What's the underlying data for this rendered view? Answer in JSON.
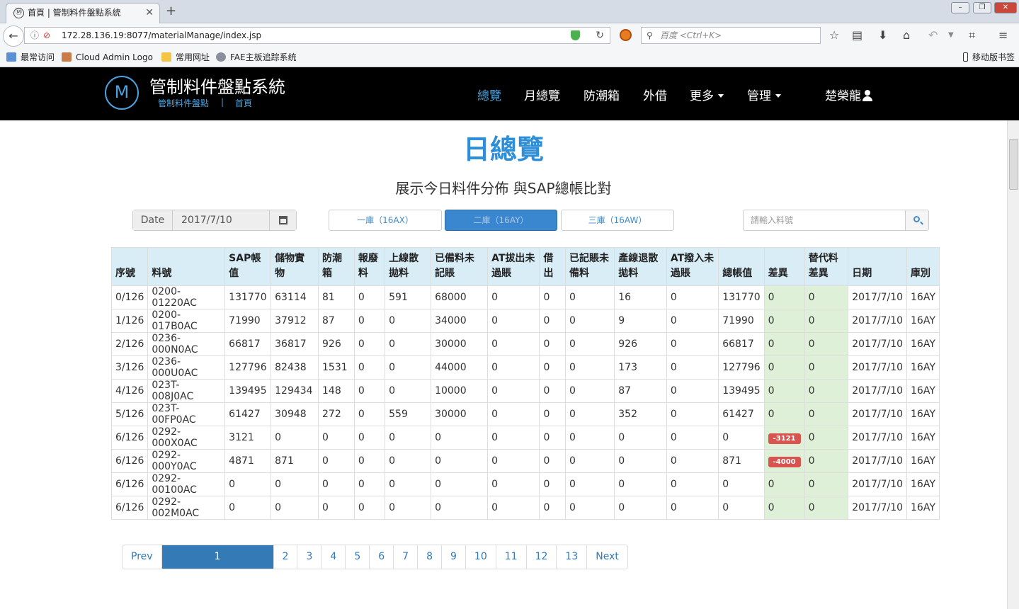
{
  "browser": {
    "tab_title": "首頁 | 管制料件盤點系統",
    "tab_favicon": "Ⓜ",
    "url": "172.28.136.19:8077/materialManage/index.jsp",
    "search_placeholder": "百度 <Ctrl+K>",
    "bookmarks": [
      "最常访问",
      "Cloud Admin Logo",
      "常用网址",
      "FAE主板追踪系统"
    ],
    "mobile_bookmarks": "移动版书签"
  },
  "header": {
    "brand": "管制料件盤點系統",
    "breadcrumb_1": "管制料件盤點",
    "breadcrumb_sep": "|",
    "breadcrumb_2": "首頁",
    "nav": [
      "總覽",
      "月總覽",
      "防潮箱",
      "外借",
      "更多",
      "管理"
    ],
    "user": "楚榮龍"
  },
  "page": {
    "title": "日總覽",
    "subtitle": "展示今日料件分佈 與SAP總帳比對"
  },
  "filters": {
    "date_label": "Date",
    "date_value": "2017/7/10",
    "stores": [
      "一庫（16AX）",
      "二庫（16AY）",
      "三庫（16AW）"
    ],
    "active_store": 1,
    "search_placeholder": "請輸入料號"
  },
  "table": {
    "headers": [
      [
        "序號"
      ],
      [
        "料號"
      ],
      [
        "SAP帳",
        "值"
      ],
      [
        "儲物實",
        "物"
      ],
      [
        "防潮",
        "箱"
      ],
      [
        "報廢",
        "料"
      ],
      [
        "上線散",
        "拋料"
      ],
      [
        "已備料未",
        "記賬"
      ],
      [
        "AT拔出未",
        "過賬"
      ],
      [
        "借",
        "出"
      ],
      [
        "已記賬未",
        "備料"
      ],
      [
        "產線退散",
        "拋料"
      ],
      [
        "AT撥入未",
        "過賬"
      ],
      [
        "總帳值"
      ],
      [
        "差異"
      ],
      [
        "替代料",
        "差異"
      ],
      [
        "日期"
      ],
      [
        "庫別"
      ]
    ],
    "rows": [
      [
        "0/126",
        "0200-01220AC",
        "131770",
        "63114",
        "81",
        "0",
        "591",
        "68000",
        "0",
        "0",
        "0",
        "16",
        "0",
        "131770",
        "0",
        "0",
        "2017/7/10",
        "16AY"
      ],
      [
        "1/126",
        "0200-017B0AC",
        "71990",
        "37912",
        "87",
        "0",
        "0",
        "34000",
        "0",
        "0",
        "0",
        "9",
        "0",
        "71990",
        "0",
        "0",
        "2017/7/10",
        "16AY"
      ],
      [
        "2/126",
        "0236-000N0AC",
        "66817",
        "36817",
        "926",
        "0",
        "0",
        "30000",
        "0",
        "0",
        "0",
        "926",
        "0",
        "66817",
        "0",
        "0",
        "2017/7/10",
        "16AY"
      ],
      [
        "3/126",
        "0236-000U0AC",
        "127796",
        "82438",
        "1531",
        "0",
        "0",
        "44000",
        "0",
        "0",
        "0",
        "173",
        "0",
        "127796",
        "0",
        "0",
        "2017/7/10",
        "16AY"
      ],
      [
        "4/126",
        "023T-008J0AC",
        "139495",
        "129434",
        "148",
        "0",
        "0",
        "10000",
        "0",
        "0",
        "0",
        "87",
        "0",
        "139495",
        "0",
        "0",
        "2017/7/10",
        "16AY"
      ],
      [
        "5/126",
        "023T-00FP0AC",
        "61427",
        "30948",
        "272",
        "0",
        "559",
        "30000",
        "0",
        "0",
        "0",
        "352",
        "0",
        "61427",
        "0",
        "0",
        "2017/7/10",
        "16AY"
      ],
      [
        "6/126",
        "0292-000X0AC",
        "3121",
        "0",
        "0",
        "0",
        "0",
        "0",
        "0",
        "0",
        "0",
        "0",
        "0",
        "0",
        "-3121",
        "0",
        "2017/7/10",
        "16AY"
      ],
      [
        "6/126",
        "0292-000Y0AC",
        "4871",
        "871",
        "0",
        "0",
        "0",
        "0",
        "0",
        "0",
        "0",
        "0",
        "0",
        "871",
        "-4000",
        "0",
        "2017/7/10",
        "16AY"
      ],
      [
        "6/126",
        "0292-00100AC",
        "0",
        "0",
        "0",
        "0",
        "0",
        "0",
        "0",
        "0",
        "0",
        "0",
        "0",
        "0",
        "0",
        "0",
        "2017/7/10",
        "16AY"
      ],
      [
        "6/126",
        "0292-002M0AC",
        "0",
        "0",
        "0",
        "0",
        "0",
        "0",
        "0",
        "0",
        "0",
        "0",
        "0",
        "0",
        "0",
        "0",
        "2017/7/10",
        "16AY"
      ]
    ]
  },
  "pagination": {
    "prev": "Prev",
    "pages": [
      "1",
      "2",
      "3",
      "4",
      "5",
      "6",
      "7",
      "8",
      "9",
      "10",
      "11",
      "12",
      "13"
    ],
    "active": "1",
    "next": "Next"
  },
  "colors": {
    "accent": "#2e8fd8",
    "header_bg": "#000000",
    "table_header_bg": "#d9edf7",
    "diff_bg": "#dff0d8",
    "negative_badge": "#d9534f"
  }
}
